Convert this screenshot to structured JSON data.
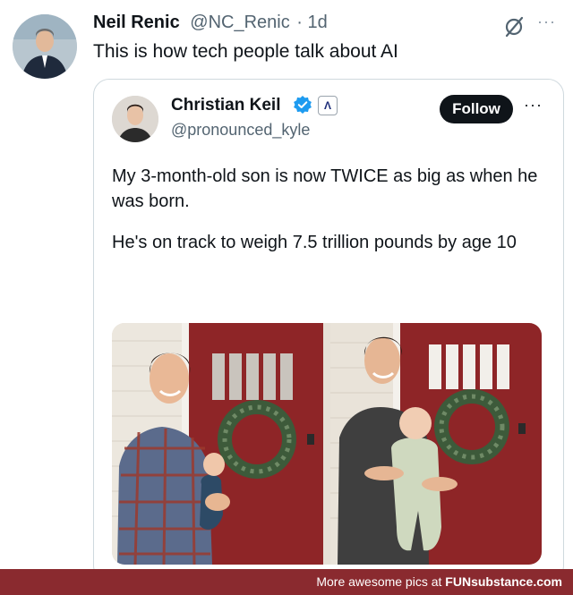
{
  "tweet": {
    "author_name": "Neil Renic",
    "author_handle": "@NC_Renic",
    "time": "· 1d",
    "text": "This is how tech people talk about AI",
    "more_icon": "more-icon",
    "action_icon": "grok-slash-icon"
  },
  "quoted": {
    "author_name": "Christian Keil",
    "author_handle": "@pronounced_kyle",
    "verified_icon": "verified-badge-icon",
    "affiliation_icon": "affiliate-logo-icon",
    "affiliation_glyph": "Λ",
    "follow_label": "Follow",
    "more_icon": "more-icon",
    "paragraph_1": "My 3-month-old son is now TWICE as big as when he was born.",
    "paragraph_2": "He's on track to weigh 7.5 trillion pounds by age 10"
  },
  "watermark": {
    "prefix": "More awesome pics at ",
    "brand": "FUNsubstance.com"
  },
  "colors": {
    "verified": "#1d9bf0",
    "follow_bg": "#0f1419",
    "door": "#8e2527",
    "watermark_bg": "#8a2a2f"
  }
}
